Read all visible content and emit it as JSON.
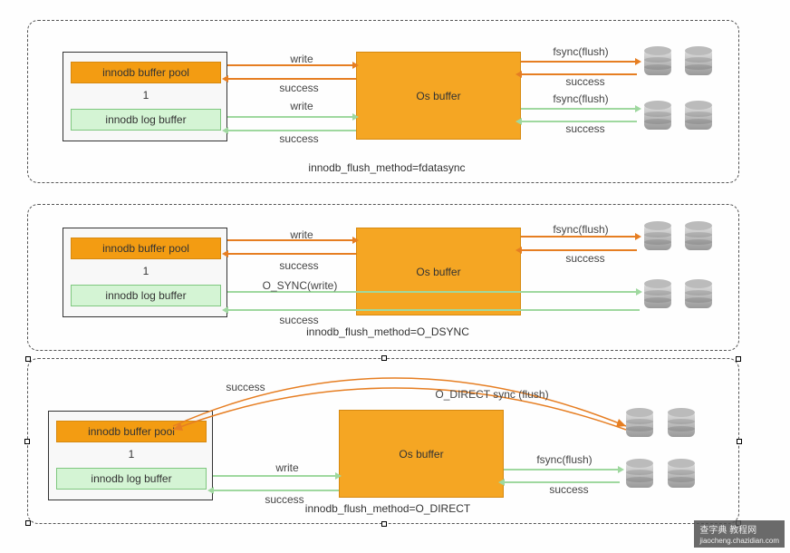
{
  "chart_data": {
    "type": "diagram",
    "title": "InnoDB flush method comparison",
    "panels": [
      {
        "method": "innodb_flush_method=fdatasync",
        "flows": [
          {
            "from": "innodb buffer pool",
            "to": "Os buffer",
            "label": "write",
            "return": "success"
          },
          {
            "from": "Os buffer",
            "to": "disk1",
            "label": "fsync(flush)",
            "return": "success"
          },
          {
            "from": "innodb log buffer",
            "to": "Os buffer",
            "label": "write",
            "return": "success"
          },
          {
            "from": "Os buffer",
            "to": "disk2",
            "label": "fsync(flush)",
            "return": "success"
          }
        ]
      },
      {
        "method": "innodb_flush_method=O_DSYNC",
        "flows": [
          {
            "from": "innodb buffer pool",
            "to": "Os buffer",
            "label": "write",
            "return": "success"
          },
          {
            "from": "Os buffer",
            "to": "disk1",
            "label": "fsync(flush)",
            "return": "success"
          },
          {
            "from": "innodb log buffer",
            "to": "disk2",
            "label": "O_SYNC(write)",
            "return": "success",
            "via": "Os buffer"
          }
        ]
      },
      {
        "method": "innodb_flush_method=O_DIRECT",
        "flows": [
          {
            "from": "innodb buffer pool",
            "to": "disk1",
            "label": "O_DIRECT   sync (flush)",
            "return": "success",
            "bypass_os_buffer": true
          },
          {
            "from": "innodb log buffer",
            "to": "Os buffer",
            "label": "write",
            "return": "success"
          },
          {
            "from": "Os buffer",
            "to": "disk2",
            "label": "fsync(flush)",
            "return": "success"
          }
        ]
      }
    ]
  },
  "labels": {
    "bufpool": "innodb buffer pool",
    "logbuf": "innodb log buffer",
    "osbuf": "Os buffer",
    "write": "write",
    "success": "success",
    "fsync": "fsync(flush)",
    "osync": "O_SYNC(write)",
    "odirect": "O_DIRECT   sync (flush)",
    "num1": "1",
    "caption1": "innodb_flush_method=fdatasync",
    "caption2": "innodb_flush_method=O_DSYNC",
    "caption3": "innodb_flush_method=O_DIRECT",
    "watermark": "查字典  教程网",
    "watermark_sub": "jiaocheng.chazidian.com"
  }
}
